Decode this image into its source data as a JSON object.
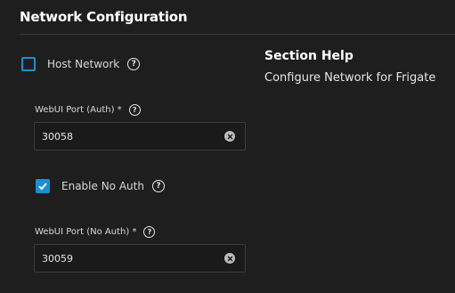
{
  "section": {
    "title": "Network Configuration"
  },
  "host_network": {
    "label": "Host Network",
    "checked": false,
    "help_icon": "help-icon"
  },
  "webui_port_auth": {
    "label": "WebUI Port (Auth) *",
    "value": "30058"
  },
  "enable_no_auth": {
    "label": "Enable No Auth",
    "checked": true
  },
  "webui_port_no_auth": {
    "label": "WebUI Port (No Auth) *",
    "value": "30059"
  },
  "section_help": {
    "title": "Section Help",
    "text": "Configure Network for Frigate"
  },
  "colors": {
    "accent": "#1a8fd1",
    "background": "#1e1e1e",
    "input_bg": "#1a1a1a"
  }
}
